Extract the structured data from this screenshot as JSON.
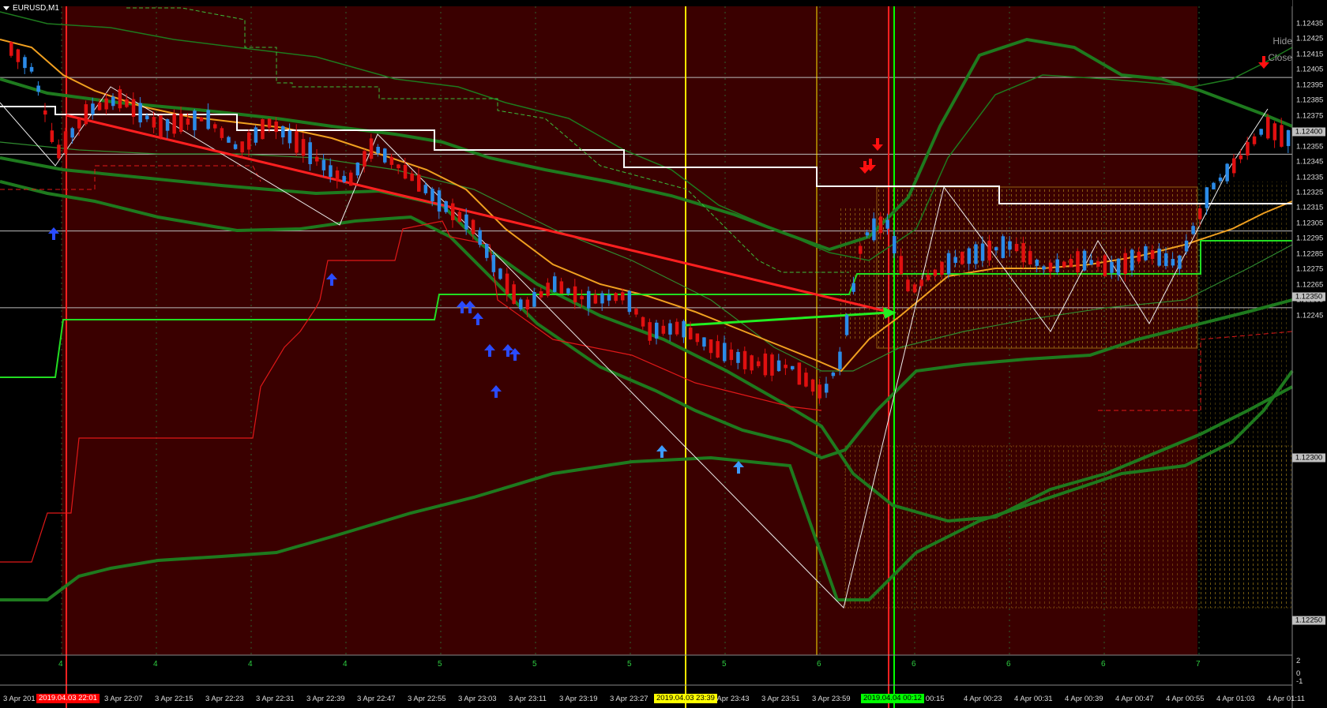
{
  "window": {
    "title": "EURUSD,M1"
  },
  "side_buttons": {
    "hide": "Hide",
    "close": "Close"
  },
  "price_axis": {
    "labels": [
      "1.12435",
      "1.12425",
      "1.12415",
      "1.12405",
      "1.12395",
      "1.12385",
      "1.12375",
      "1.12365",
      "1.12355",
      "1.12345",
      "1.12335",
      "1.12325",
      "1.12315",
      "1.12305",
      "1.12295",
      "1.12285",
      "1.12275",
      "1.12265",
      "1.12255",
      "1.12245"
    ],
    "boxes": [
      "1.12400",
      "1.12350",
      "1.12300",
      "1.12250"
    ]
  },
  "sub_window_axis": {
    "top": "2",
    "zero": "0",
    "bottom": "-1"
  },
  "day_labels": [
    "4",
    "4",
    "4",
    "4",
    "5",
    "5",
    "5",
    "5",
    "6",
    "6",
    "6",
    "6",
    "7"
  ],
  "time_axis": {
    "labels": [
      "3 Apr 201",
      "3 Apr 22:07",
      "3 Apr 22:15",
      "3 Apr 22:23",
      "3 Apr 22:31",
      "3 Apr 22:39",
      "3 Apr 22:47",
      "3 Apr 22:55",
      "3 Apr 23:03",
      "3 Apr 23:11",
      "3 Apr 23:19",
      "3 Apr 23:27",
      "3 Apr 23:43",
      "3 Apr 23:51",
      "3 Apr 23:59",
      "r 00:15",
      "4 Apr 00:23",
      "4 Apr 00:31",
      "4 Apr 00:39",
      "4 Apr 00:47",
      "4 Apr 00:55",
      "4 Apr 01:03",
      "4 Apr 01:11"
    ],
    "markers": [
      {
        "text": "2019.04.03 22:01",
        "bg": "#ff0000",
        "fg": "#ffffff"
      },
      {
        "text": "2019.04.03 23:39",
        "bg": "#ffff00",
        "fg": "#000000"
      },
      {
        "text": "2019.04.04 00:12",
        "bg": "#00ff00",
        "fg": "#000000"
      }
    ]
  },
  "colors": {
    "background": "#000000",
    "shaded_zone": "#3a0000",
    "bull_candle": "#2b8be8",
    "bear_candle": "#e01010",
    "bands": "#1e7a1e",
    "ma": "#f0a020",
    "level_white": "#ffffff",
    "level_green": "#22dd22",
    "trend_red": "#ff2020",
    "arrow_up": "#2a4bff",
    "arrow_down": "#ff1010"
  },
  "icons": [
    "dropdown-triangle-icon",
    "buy-arrow-icon",
    "sell-arrow-icon"
  ]
}
